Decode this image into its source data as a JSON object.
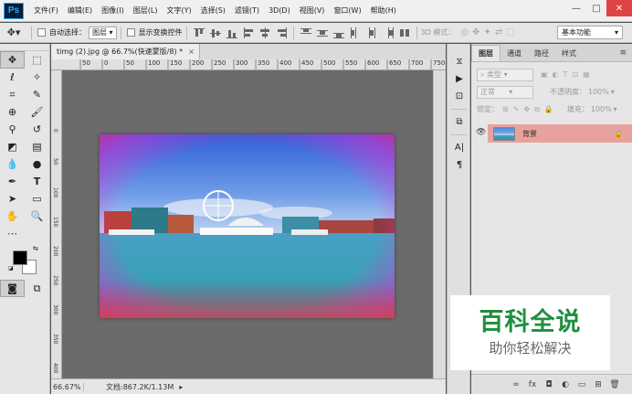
{
  "app": {
    "logo_text": "Ps"
  },
  "menu": [
    "文件(F)",
    "编辑(E)",
    "图像(I)",
    "图层(L)",
    "文字(Y)",
    "选择(S)",
    "滤镜(T)",
    "3D(D)",
    "视图(V)",
    "窗口(W)",
    "帮助(H)"
  ],
  "window_controls": {
    "minimize": "—",
    "maximize": "□",
    "close": "✕"
  },
  "options_bar": {
    "auto_select_label": "自动选择：",
    "auto_select_value": "图层",
    "show_transform_label": "显示变换控件",
    "mode_3d_label": "3D 模式：",
    "workspace": "基本功能"
  },
  "document": {
    "tab_title": "timg (2).jpg @ 66.7%(快速蒙版/8) *",
    "tab_close": "×",
    "ruler_top_labels": [
      "50",
      "0",
      "50",
      "100",
      "150",
      "200",
      "250",
      "300",
      "350",
      "400",
      "450",
      "500",
      "550",
      "600",
      "650",
      "700",
      "750"
    ],
    "ruler_left_labels": [
      "0",
      "50",
      "100",
      "150",
      "200",
      "250",
      "300",
      "350",
      "400"
    ]
  },
  "status": {
    "zoom": "66.67%",
    "doc_info": "文档:867.2K/1.13M"
  },
  "panels": {
    "tabs": [
      "图层",
      "通道",
      "路径",
      "样式"
    ],
    "active_tab": "图层",
    "filter_type": "类型",
    "blend_mode": "正常",
    "opacity_label": "不透明度：",
    "opacity_value": "100%",
    "lock_label": "锁定：",
    "fill_label": "填充：",
    "fill_value": "100%",
    "layer_name": "背景"
  },
  "watermark": {
    "main": "百科全说",
    "sub": "助你轻松解决"
  },
  "colors": {
    "accent_layer": "#e8a29d",
    "ps_blue": "#31a8ff",
    "watermark_green": "#1f8f3f"
  }
}
